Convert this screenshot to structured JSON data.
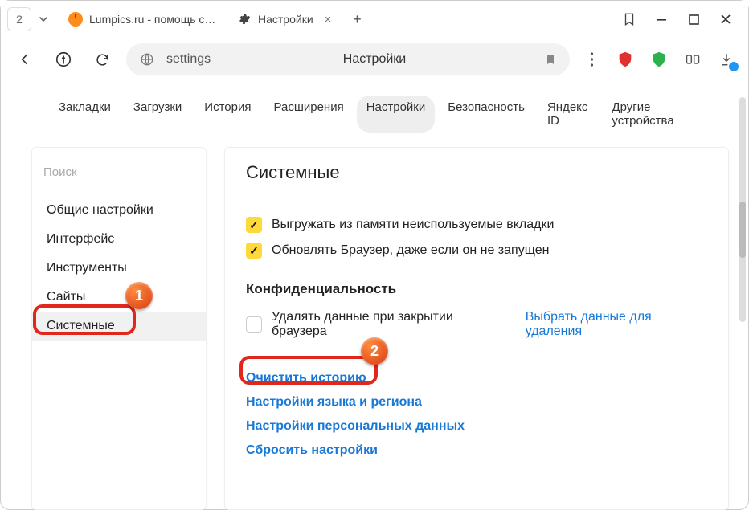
{
  "titlebar": {
    "counter": "2",
    "tabs": [
      {
        "label": "Lumpics.ru - помощь с ком"
      },
      {
        "label": "Настройки"
      }
    ]
  },
  "addr": {
    "url": "settings",
    "heading": "Настройки"
  },
  "nav": {
    "items": [
      "Закладки",
      "Загрузки",
      "История",
      "Расширения",
      "Настройки",
      "Безопасность",
      "Яндекс ID",
      "Другие устройства"
    ],
    "selectedIndex": 4
  },
  "sidebar": {
    "search_placeholder": "Поиск",
    "items": [
      "Общие настройки",
      "Интерфейс",
      "Инструменты",
      "Сайты",
      "Системные"
    ],
    "selectedIndex": 4
  },
  "content": {
    "title": "Системные",
    "checks": [
      {
        "checked": true,
        "label": "Выгружать из памяти неиспользуемые вкладки"
      },
      {
        "checked": true,
        "label": "Обновлять Браузер, даже если он не запущен"
      }
    ],
    "privacy_heading": "Конфиденциальность",
    "privacy_check": {
      "checked": false,
      "label": "Удалять данные при закрытии браузера"
    },
    "privacy_link": "Выбрать данные для удаления",
    "links": [
      "Очистить историю",
      "Настройки языка и региона",
      "Настройки персональных данных",
      "Сбросить настройки"
    ]
  },
  "markers": {
    "one": "1",
    "two": "2"
  }
}
